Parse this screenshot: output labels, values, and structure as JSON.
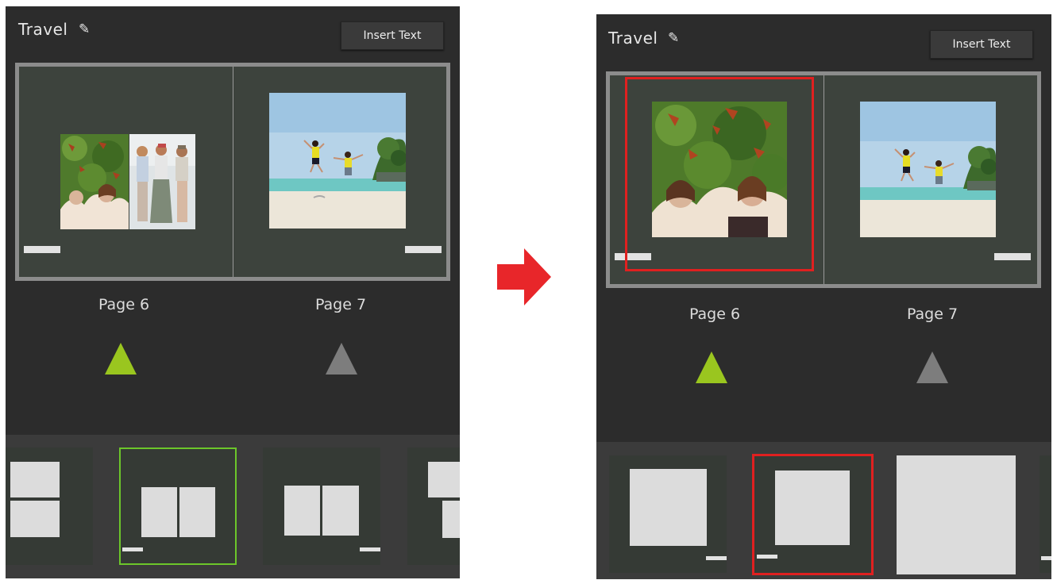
{
  "left": {
    "album_title": "Travel",
    "insert_text_label": "Insert Text",
    "page_left_label": "Page 6",
    "page_right_label": "Page 7"
  },
  "right": {
    "album_title": "Travel",
    "insert_text_label": "Insert Text",
    "page_left_label": "Page 6",
    "page_right_label": "Page 7"
  },
  "icons": {
    "edit": "pencil-icon",
    "transition": "right-arrow-icon",
    "active_page": "triangle-up-icon",
    "inactive_page": "triangle-up-icon"
  },
  "colors": {
    "panel_bg": "#2c2c2c",
    "page_bg": "#3d433d",
    "active_triangle": "#9ac61f",
    "inactive_triangle": "#7d7d7d",
    "selected_green": "#6cc62a",
    "highlight_red": "#e02020",
    "arrow_red": "#e8262a"
  }
}
